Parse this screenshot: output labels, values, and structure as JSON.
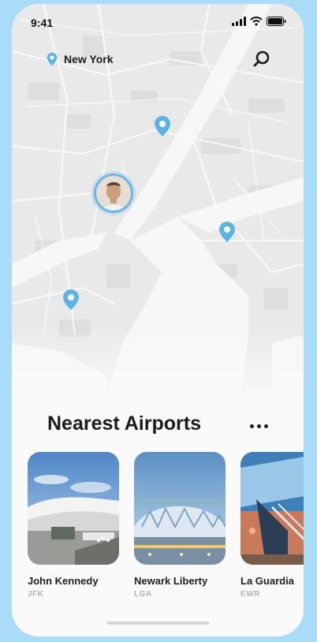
{
  "status_bar": {
    "time": "9:41"
  },
  "location": {
    "city": "New York"
  },
  "colors": {
    "accent": "#5db3e4",
    "background": "#a9dcf6",
    "title": "#1c1c1c",
    "muted": "#b3b3b3"
  },
  "icons": {
    "location": "pin-icon",
    "search": "search-icon",
    "more": "more-icon"
  },
  "section": {
    "title": "Nearest Airports"
  },
  "airports": [
    {
      "name": "John Kennedy",
      "code": "JFK"
    },
    {
      "name": "Newark Liberty",
      "code": "LGA"
    },
    {
      "name": "La Guardia",
      "code": "EWR"
    }
  ]
}
